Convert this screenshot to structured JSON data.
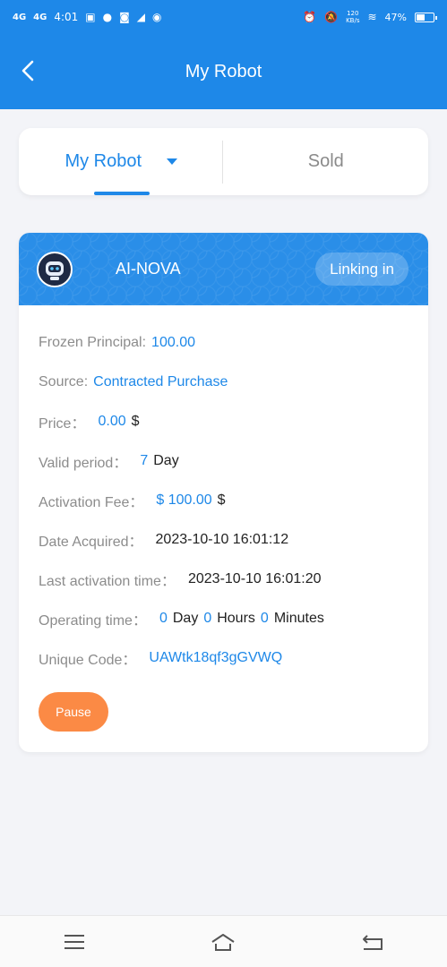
{
  "status_bar": {
    "signal_1": "4G",
    "signal_2": "4G",
    "time": "4:01",
    "speed": "120",
    "speed_unit": "KB/s",
    "battery": "47%"
  },
  "header": {
    "title": "My Robot"
  },
  "tabs": [
    {
      "label": "My Robot",
      "active": true
    },
    {
      "label": "Sold",
      "active": false
    }
  ],
  "robot": {
    "name": "AI-NOVA",
    "status": "Linking in",
    "fields": {
      "frozen_principal_label": "Frozen Principal:",
      "frozen_principal_value": "100.00",
      "source_label": "Source:",
      "source_value": "Contracted Purchase",
      "price_label": "Price：",
      "price_value": "0.00",
      "price_unit": "$",
      "valid_period_label": "Valid period：",
      "valid_period_value": "7",
      "valid_period_unit": "Day",
      "activation_fee_label": "Activation Fee：",
      "activation_fee_value": "$ 100.00",
      "activation_fee_unit": "$",
      "date_acquired_label": "Date Acquired：",
      "date_acquired_value": "2023-10-10 16:01:12",
      "last_activation_label": "Last activation time：",
      "last_activation_value": "2023-10-10 16:01:20",
      "operating_time_label": "Operating time：",
      "op_days": "0",
      "op_days_unit": "Day",
      "op_hours": "0",
      "op_hours_unit": "Hours",
      "op_minutes": "0",
      "op_minutes_unit": "Minutes",
      "unique_code_label": "Unique Code：",
      "unique_code_value": "UAWtk18qf3gGVWQ"
    },
    "pause_label": "Pause"
  },
  "colors": {
    "primary": "#1e88e8",
    "accent_orange": "#fb8a45",
    "background": "#f3f4f8"
  },
  "icons": {
    "back": "back-arrow-icon",
    "menu": "menu-icon",
    "home": "home-icon",
    "return": "return-icon"
  }
}
